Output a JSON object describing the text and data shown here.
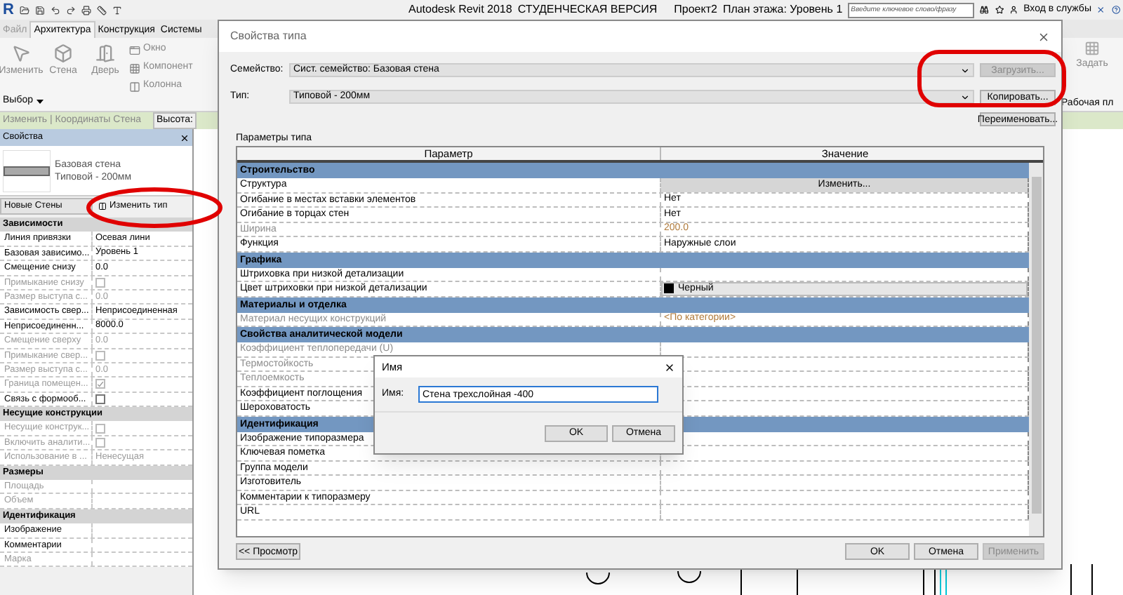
{
  "app_bar": {
    "logo": "R",
    "title": "Autodesk Revit 2018",
    "edition": "СТУДЕНЧЕСКАЯ ВЕРСИЯ",
    "project": "Проект2",
    "view": "План этажа: Уровень 1",
    "search": {
      "placeholder": "Введите ключевое слово/фразу"
    },
    "sign_in": "Вход в службы"
  },
  "ribbon_tabs": [
    {
      "label": "Файл",
      "selected": false
    },
    {
      "label": "Архитектура",
      "selected": true
    },
    {
      "label": "Конструкция",
      "selected": false
    },
    {
      "label": "Системы",
      "selected": false
    }
  ],
  "ribbon_tools": [
    {
      "label": "Изменить",
      "kind": "large"
    },
    {
      "label": "Стена",
      "kind": "large"
    },
    {
      "label": "Дверь",
      "kind": "large"
    },
    {
      "label": "Окно",
      "kind": "small"
    },
    {
      "label": "Компонент",
      "kind": "small"
    },
    {
      "label": "Колонна",
      "kind": "small"
    }
  ],
  "ribbon_panel": "Выбор",
  "ribbon_right": {
    "tool": "Задать",
    "panel": "Рабочая пл"
  },
  "options_bar": {
    "context": "Изменить | Координаты Стена",
    "height_label": "Высота:"
  },
  "properties": {
    "title": "Свойства",
    "type_family": "Базовая стена",
    "type_name": "Типовой - 200мм",
    "instance_filter": "Новые Стены",
    "edit_type": "Изменить тип",
    "sections": [
      {
        "title": "Зависимости",
        "rows": [
          {
            "label": "Линия привязки",
            "kind": "text",
            "value": "Осевая лини",
            "disabled": false
          },
          {
            "label": "Базовая зависимо...",
            "kind": "text",
            "value": "Уровень 1",
            "disabled": false
          },
          {
            "label": "Смещение снизу",
            "kind": "text",
            "value": "0.0",
            "disabled": false
          },
          {
            "label": "Примыкание снизу",
            "kind": "checkbox",
            "checked": false,
            "disabled": true
          },
          {
            "label": "Размер выступа с...",
            "kind": "text",
            "value": "0.0",
            "disabled": true
          },
          {
            "label": "Зависимость свер...",
            "kind": "text",
            "value": "Неприсоединенная",
            "disabled": false
          },
          {
            "label": "Неприсоединенн...",
            "kind": "text",
            "value": "8000.0",
            "disabled": false
          },
          {
            "label": "Смещение сверху",
            "kind": "text",
            "value": "0.0",
            "disabled": true
          },
          {
            "label": "Примыкание свер...",
            "kind": "checkbox",
            "checked": false,
            "disabled": true
          },
          {
            "label": "Размер выступа с...",
            "kind": "text",
            "value": "0.0",
            "disabled": true
          },
          {
            "label": "Граница помещен...",
            "kind": "checkbox",
            "checked": true,
            "disabled": true
          },
          {
            "label": "Связь с формооб...",
            "kind": "checkbox",
            "checked": false,
            "disabled": false
          }
        ]
      },
      {
        "title": "Несущие конструкции",
        "rows": [
          {
            "label": "Несущие конструк...",
            "kind": "checkbox",
            "checked": false,
            "disabled": true
          },
          {
            "label": "Включить аналити...",
            "kind": "checkbox",
            "checked": false,
            "disabled": true
          },
          {
            "label": "Использование в ...",
            "kind": "text",
            "value": "Ненесущая",
            "disabled": true
          }
        ]
      },
      {
        "title": "Размеры",
        "rows": [
          {
            "label": "Площадь",
            "kind": "text",
            "disabled": true
          },
          {
            "label": "Объем",
            "kind": "text",
            "disabled": true
          }
        ]
      },
      {
        "title": "Идентификация",
        "rows": [
          {
            "label": "Изображение",
            "kind": "text",
            "disabled": false
          },
          {
            "label": "Комментарии",
            "kind": "text",
            "disabled": false
          },
          {
            "label": "Марка",
            "kind": "text",
            "disabled": true
          }
        ]
      }
    ]
  },
  "type_dialog": {
    "title": "Свойства типа",
    "family_label": "Семейство:",
    "family": "Сист. семейство: Базовая стена",
    "load_button": {
      "label": "Загрузить...",
      "disabled": true
    },
    "type_label": "Тип:",
    "type": "Типовой - 200мм",
    "duplicate_button": "Копировать...",
    "rename_button": "Переименовать...",
    "params_label": "Параметры типа",
    "columns": [
      "Параметр",
      "Значение"
    ],
    "sections": [
      {
        "title": "Строительство",
        "rows": [
          {
            "label": "Структура",
            "kind": "button",
            "value": "Изменить...",
            "disabled": false
          },
          {
            "label": "Огибание в местах вставки элементов",
            "kind": "text",
            "value": "Нет",
            "disabled": false
          },
          {
            "label": "Огибание в торцах стен",
            "kind": "text",
            "value": "Нет",
            "disabled": false
          },
          {
            "label": "Ширина",
            "kind": "text",
            "value": "200.0",
            "disabled": true
          },
          {
            "label": "Функция",
            "kind": "text",
            "value": "Наружные слои",
            "disabled": false
          }
        ]
      },
      {
        "title": "Графика",
        "rows": [
          {
            "label": "Штриховка при низкой детализации",
            "kind": "text",
            "disabled": false
          },
          {
            "label": "Цвет штриховки при низкой детализации",
            "kind": "color",
            "value": "Черный",
            "color": "#000000",
            "disabled": false
          }
        ]
      },
      {
        "title": "Материалы и отделка",
        "rows": [
          {
            "label": "Материал несущих конструкций",
            "kind": "text",
            "value": "<По категории>",
            "disabled": true
          }
        ]
      },
      {
        "title": "Свойства аналитической модели",
        "rows": [
          {
            "label": "Коэффициент теплопередачи (U)",
            "kind": "text",
            "disabled": true
          },
          {
            "label": "Термостойкость",
            "kind": "text",
            "disabled": true
          },
          {
            "label": "Теплоемкость",
            "kind": "text",
            "disabled": true
          },
          {
            "label": "Коэффициент поглощения",
            "kind": "text",
            "disabled": false
          },
          {
            "label": "Шероховатость",
            "kind": "text",
            "disabled": false
          }
        ]
      },
      {
        "title": "Идентификация",
        "rows": [
          {
            "label": "Изображение типоразмера",
            "kind": "text",
            "disabled": false
          },
          {
            "label": "Ключевая пометка",
            "kind": "text",
            "disabled": false
          },
          {
            "label": "Группа модели",
            "kind": "text",
            "disabled": false
          },
          {
            "label": "Изготовитель",
            "kind": "text",
            "disabled": false
          },
          {
            "label": "Комментарии к типоразмеру",
            "kind": "text",
            "disabled": false
          },
          {
            "label": "URL",
            "kind": "text",
            "disabled": false
          }
        ]
      }
    ],
    "preview_button": "<< Просмотр",
    "ok_button": "OK",
    "cancel_button": "Отмена",
    "apply_button": {
      "label": "Применить",
      "disabled": true
    }
  },
  "name_dialog": {
    "title": "Имя",
    "name_label": "Имя:",
    "name_value": "Стена трехслойная -400",
    "ok_button": "OK",
    "cancel_button": "Отмена"
  }
}
